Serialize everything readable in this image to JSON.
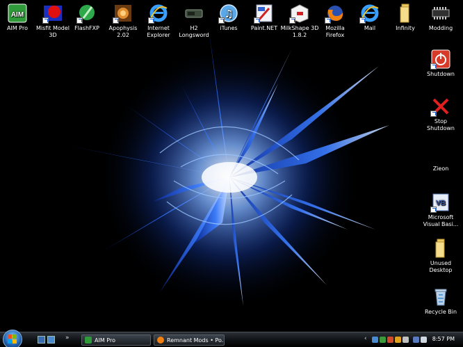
{
  "desktop": {
    "top_icons": [
      {
        "label": "AIM Pro",
        "icon": "aim-pro-icon"
      },
      {
        "label": "Misfit Model 3D",
        "icon": "misfit-model-icon"
      },
      {
        "label": "FlashFXP",
        "icon": "flashfxp-icon"
      },
      {
        "label": "Apophysis 2.02",
        "icon": "apophysis-icon"
      },
      {
        "label": "Internet Explorer",
        "icon": "internet-explorer-icon"
      },
      {
        "label": "H2 Longsword",
        "icon": "h2-longsword-icon"
      },
      {
        "label": "iTunes",
        "icon": "itunes-icon"
      },
      {
        "label": "Paint.NET",
        "icon": "paint-net-icon"
      },
      {
        "label": "MilkShape 3D 1.8.2",
        "icon": "milkshape-icon"
      },
      {
        "label": "Mozilla Firefox",
        "icon": "firefox-icon"
      },
      {
        "label": "Mail",
        "icon": "mail-icon"
      },
      {
        "label": "Infinity",
        "icon": "folder-icon"
      },
      {
        "label": "Modding",
        "icon": "memory-chip-icon"
      }
    ],
    "right_icons": [
      {
        "label": "Shutdown",
        "icon": "shutdown-icon"
      },
      {
        "label": "Stop Shutdown",
        "icon": "stop-shutdown-icon"
      },
      {
        "label": "Zieon",
        "icon": ""
      },
      {
        "label": "Microsoft Visual Basi...",
        "icon": "visual-basic-icon"
      },
      {
        "label": "Unused Desktop",
        "icon": "folder-icon"
      },
      {
        "label": "Recycle Bin",
        "icon": "recycle-bin-icon"
      }
    ]
  },
  "taskbar": {
    "quick_launch_chevron": "»",
    "tasks": [
      {
        "label": "AIM Pro",
        "icon": "aim-pro-icon"
      },
      {
        "label": "Remnant Mods • Po...",
        "icon": "firefox-icon"
      }
    ],
    "tray_chevron": "‹",
    "clock": "8:57 PM"
  },
  "colors": {
    "wallpaper_bg": "#000000",
    "wallpaper_accent": "#2a6cff",
    "taskbar": "#14181c"
  }
}
